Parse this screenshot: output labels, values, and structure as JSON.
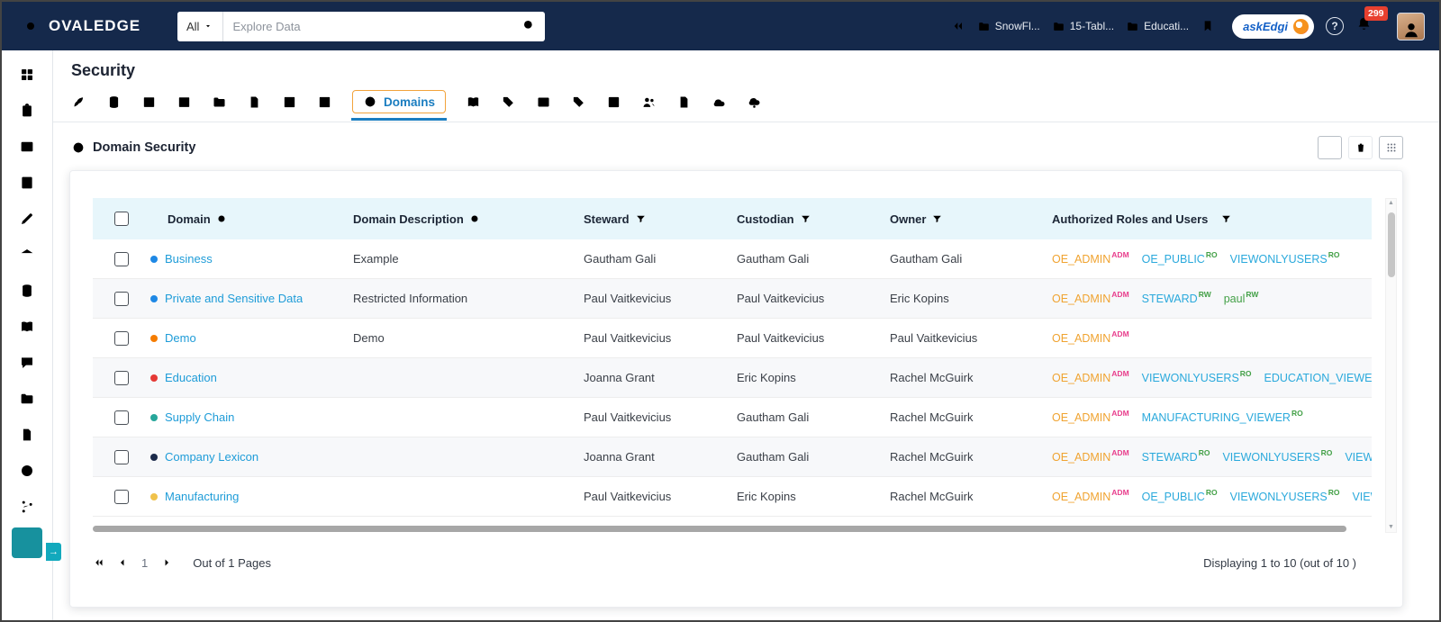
{
  "navbar": {
    "logo_text": "OVALEDGE",
    "search_scope": "All",
    "search_placeholder": "Explore Data",
    "recent_items": [
      "SnowFl...",
      "15-Tabl...",
      "Educati..."
    ],
    "ask_edgi_label": "askEdgi",
    "notification_count": "299"
  },
  "sidebar": {
    "items": [
      {
        "name": "home",
        "icon": "grid",
        "muted": true
      },
      {
        "name": "reports",
        "icon": "clipboard"
      },
      {
        "name": "media",
        "icon": "image"
      },
      {
        "name": "forms",
        "icon": "form"
      },
      {
        "name": "edit",
        "icon": "pen"
      },
      {
        "name": "governance",
        "icon": "bank"
      },
      {
        "name": "data-catalog",
        "icon": "database"
      },
      {
        "name": "glossary",
        "icon": "book"
      },
      {
        "name": "collaboration",
        "icon": "chat"
      },
      {
        "name": "projects",
        "icon": "folder"
      },
      {
        "name": "certification",
        "icon": "doccheck"
      },
      {
        "name": "scheduler",
        "icon": "clock"
      },
      {
        "name": "lineage",
        "icon": "branch"
      },
      {
        "name": "analytics",
        "icon": "chart",
        "active": true
      }
    ]
  },
  "page": {
    "title": "Security"
  },
  "tabs": {
    "active_label": "Domains",
    "left_icons": [
      {
        "name": "launch",
        "icon": "rocket"
      },
      {
        "name": "databases",
        "icon": "database"
      },
      {
        "name": "tables",
        "icon": "table"
      },
      {
        "name": "columns",
        "icon": "columns"
      },
      {
        "name": "folders",
        "icon": "folder"
      },
      {
        "name": "certified-docs",
        "icon": "doccheck"
      },
      {
        "name": "reports",
        "icon": "barchart"
      },
      {
        "name": "analytics",
        "icon": "combochart"
      }
    ],
    "right_icons": [
      {
        "name": "glossary",
        "icon": "book"
      },
      {
        "name": "tags",
        "icon": "tag"
      },
      {
        "name": "media",
        "icon": "image"
      },
      {
        "name": "labels",
        "icon": "tag"
      },
      {
        "name": "queries",
        "icon": "code"
      },
      {
        "name": "users",
        "icon": "users"
      },
      {
        "name": "files",
        "icon": "file"
      },
      {
        "name": "cloud",
        "icon": "cloud"
      },
      {
        "name": "cloud-services",
        "icon": "cloudgear"
      }
    ]
  },
  "section": {
    "title": "Domain Security"
  },
  "table": {
    "headers": {
      "domain": "Domain",
      "description": "Domain Description",
      "steward": "Steward",
      "custodian": "Custodian",
      "owner": "Owner",
      "roles": "Authorized Roles and Users"
    },
    "rows": [
      {
        "domain": "Business",
        "dot": "#1e88e5",
        "description": "Example",
        "steward": "Gautham Gali",
        "custodian": "Gautham Gali",
        "owner": "Gautham Gali",
        "roles": [
          {
            "name": "OE_ADMIN",
            "sup": "ADM",
            "kind": "admin"
          },
          {
            "name": "OE_PUBLIC",
            "sup": "RO",
            "kind": "role"
          },
          {
            "name": "VIEWONLYUSERS",
            "sup": "RO",
            "kind": "role"
          }
        ]
      },
      {
        "domain": "Private and Sensitive Data",
        "dot": "#1e88e5",
        "description": "Restricted Information",
        "steward": "Paul Vaitkevicius",
        "custodian": "Paul Vaitkevicius",
        "owner": "Eric Kopins",
        "roles": [
          {
            "name": "OE_ADMIN",
            "sup": "ADM",
            "kind": "admin"
          },
          {
            "name": "STEWARD",
            "sup": "RW",
            "kind": "role"
          },
          {
            "name": "paul",
            "sup": "RW",
            "kind": "user"
          }
        ]
      },
      {
        "domain": "Demo",
        "dot": "#f57c00",
        "description": "Demo",
        "steward": "Paul Vaitkevicius",
        "custodian": "Paul Vaitkevicius",
        "owner": "Paul Vaitkevicius",
        "roles": [
          {
            "name": "OE_ADMIN",
            "sup": "ADM",
            "kind": "admin"
          }
        ]
      },
      {
        "domain": "Education",
        "dot": "#e53935",
        "description": "",
        "steward": "Joanna Grant",
        "custodian": "Eric Kopins",
        "owner": "Rachel McGuirk",
        "roles": [
          {
            "name": "OE_ADMIN",
            "sup": "ADM",
            "kind": "admin"
          },
          {
            "name": "VIEWONLYUSERS",
            "sup": "RO",
            "kind": "role"
          },
          {
            "name": "EDUCATION_VIEWER",
            "sup": "R",
            "kind": "role",
            "trail": "…"
          }
        ]
      },
      {
        "domain": "Supply Chain",
        "dot": "#26a69a",
        "description": "",
        "steward": "Paul Vaitkevicius",
        "custodian": "Gautham Gali",
        "owner": "Rachel McGuirk",
        "roles": [
          {
            "name": "OE_ADMIN",
            "sup": "ADM",
            "kind": "admin"
          },
          {
            "name": "MANUFACTURING_VIEWER",
            "sup": "RO",
            "kind": "role"
          }
        ]
      },
      {
        "domain": "Company Lexicon",
        "dot": "#1b2a4a",
        "description": "",
        "steward": "Joanna Grant",
        "custodian": "Gautham Gali",
        "owner": "Rachel McGuirk",
        "roles": [
          {
            "name": "OE_ADMIN",
            "sup": "ADM",
            "kind": "admin"
          },
          {
            "name": "STEWARD",
            "sup": "RO",
            "kind": "role"
          },
          {
            "name": "VIEWONLYUSERS",
            "sup": "RO",
            "kind": "role"
          },
          {
            "name": "VIEWER…",
            "sup": "",
            "kind": "role"
          }
        ]
      },
      {
        "domain": "Manufacturing",
        "dot": "#f0c24b",
        "description": "",
        "steward": "Paul Vaitkevicius",
        "custodian": "Eric Kopins",
        "owner": "Rachel McGuirk",
        "roles": [
          {
            "name": "OE_ADMIN",
            "sup": "ADM",
            "kind": "admin"
          },
          {
            "name": "OE_PUBLIC",
            "sup": "RO",
            "kind": "role"
          },
          {
            "name": "VIEWONLYUSERS",
            "sup": "RO",
            "kind": "role"
          },
          {
            "name": "VIEWE…",
            "sup": "",
            "kind": "role"
          }
        ]
      }
    ]
  },
  "pagination": {
    "current_page": "1",
    "pages_label": "Out of 1 Pages",
    "displaying_label": "Displaying 1 to 10  (out of 10 )"
  },
  "colors": {
    "navbar_bg": "#15294b",
    "active_sidebar": "#17919e",
    "active_tab": "#1a7dc0",
    "tab_border": "#f2a33c",
    "badge_bg": "#e8402f",
    "domain_link": "#1e9cd8",
    "admin_role": "#f0a330",
    "adm_sup": "#e83e8c",
    "role_link": "#2aa9dc",
    "perm_sup": "#43a047",
    "user_name": "#43a047",
    "header_bg": "#e7f6fb"
  }
}
